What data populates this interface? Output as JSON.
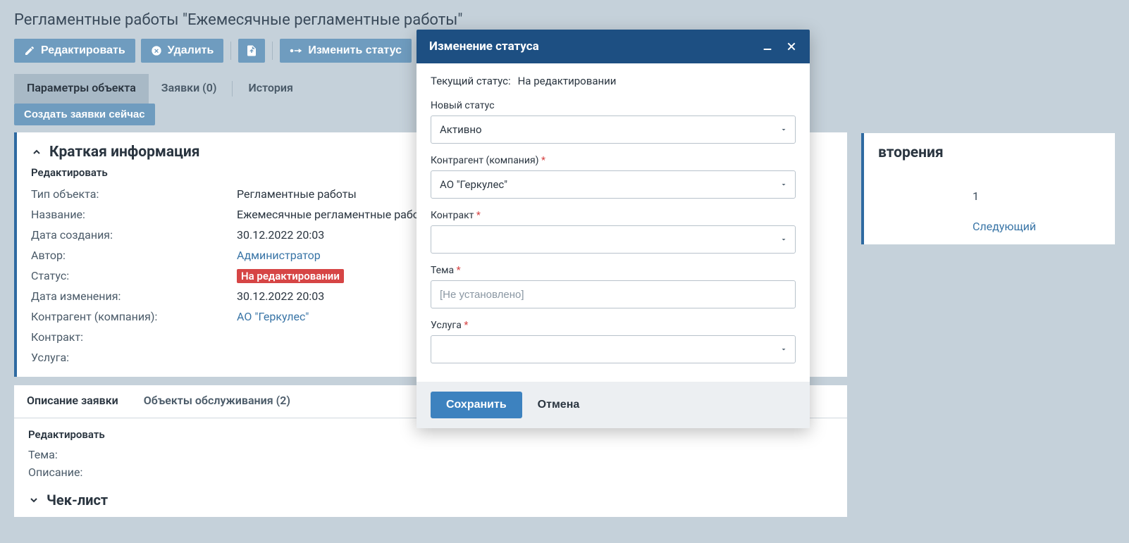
{
  "page_title": "Регламентные работы \"Ежемесячные регламентные работы\"",
  "toolbar": {
    "edit": "Редактировать",
    "delete": "Удалить",
    "change_status": "Изменить статус"
  },
  "main_tabs": {
    "params": "Параметры объекта",
    "requests": "Заявки (0)",
    "history": "История"
  },
  "create_requests_now": "Создать заявки сейчас",
  "summary": {
    "title": "Краткая информация",
    "edit": "Редактировать",
    "fields": {
      "object_type_label": "Тип объекта:",
      "object_type_value": "Регламентные работы",
      "name_label": "Название:",
      "name_value": "Ежемесячные регламентные работы",
      "created_label": "Дата создания:",
      "created_value": "30.12.2022 20:03",
      "author_label": "Автор:",
      "author_value": "Администратор",
      "status_label": "Статус:",
      "status_value": "На редактировании",
      "modified_label": "Дата изменения:",
      "modified_value": "30.12.2022 20:03",
      "contragent_label": "Контрагент (компания):",
      "contragent_value": "АО \"Геркулес\"",
      "contract_label": "Контракт:",
      "contract_value": "",
      "service_label": "Услуга:",
      "service_value": ""
    }
  },
  "right_panel": {
    "title_suffix": "вторения",
    "row1_value": "1",
    "next_label": "Следующий"
  },
  "sub_tabs": {
    "desc": "Описание заявки",
    "objects": "Объекты обслуживания (2)"
  },
  "desc_panel": {
    "edit": "Редактировать",
    "subject_label": "Тема:",
    "desc_label": "Описание:"
  },
  "checklist_title": "Чек-лист",
  "modal": {
    "title": "Изменение статуса",
    "current_label": "Текущий статус:",
    "current_value": "На редактировании",
    "new_status_label": "Новый статус",
    "new_status_value": "Активно",
    "contragent_label": "Контрагент (компания)",
    "contragent_value": "АО \"Геркулес\"",
    "contract_label": "Контракт",
    "subject_label": "Тема",
    "subject_placeholder": "[Не установлено]",
    "service_label": "Услуга",
    "save": "Сохранить",
    "cancel": "Отмена"
  }
}
